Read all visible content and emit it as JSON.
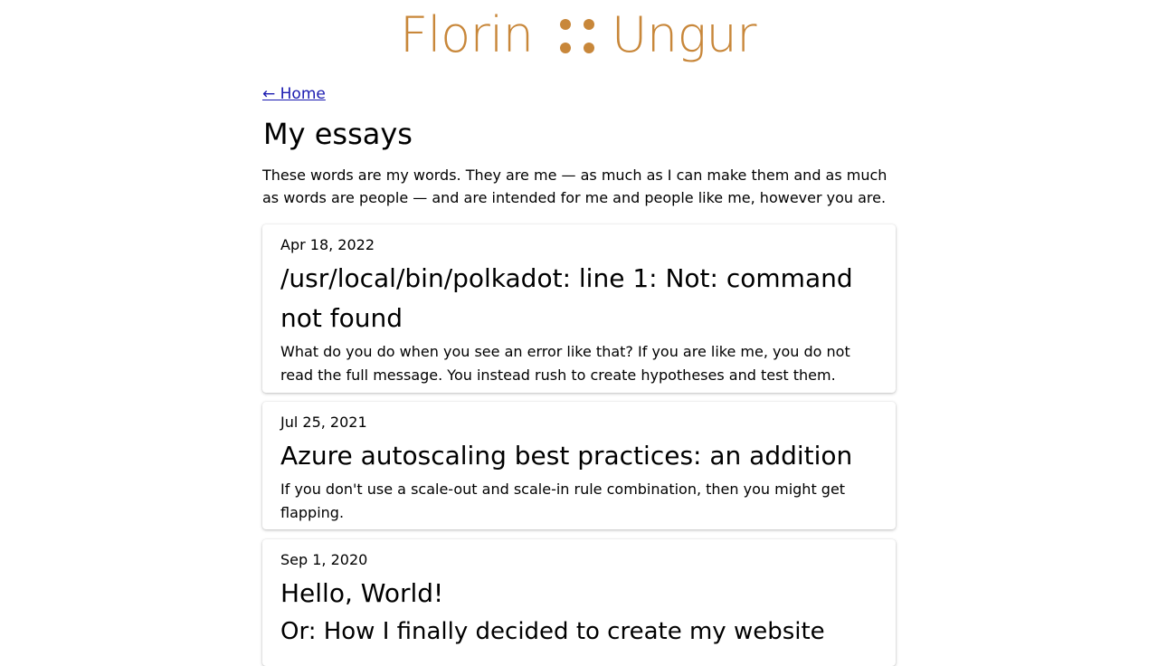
{
  "site": {
    "logo_first": "Florin",
    "logo_last": "Ungur"
  },
  "nav": {
    "home_link": "← Home"
  },
  "page": {
    "title": "My essays",
    "intro": "These words are my words. They are me — as much as I can make them and as much as words are people — and are intended for me and people like me, however you are."
  },
  "essays": [
    {
      "date": "Apr 18, 2022",
      "title": "/usr/local/bin/polkadot: line 1: Not: command not found",
      "excerpt": "What do you do when you see an error like that? If you are like me, you do not read the full message. You instead rush to create hypotheses and test them."
    },
    {
      "date": "Jul 25, 2021",
      "title": "Azure autoscaling best practices: an addition",
      "excerpt": "If you don't use a scale-out and scale-in rule combination, then you might get flapping."
    },
    {
      "date": "Sep 1, 2020",
      "title": "Hello, World!",
      "subtitle": "Or: How I finally decided to create my website"
    }
  ],
  "colors": {
    "brand": "#c8873a",
    "link": "#1a1ab0"
  }
}
